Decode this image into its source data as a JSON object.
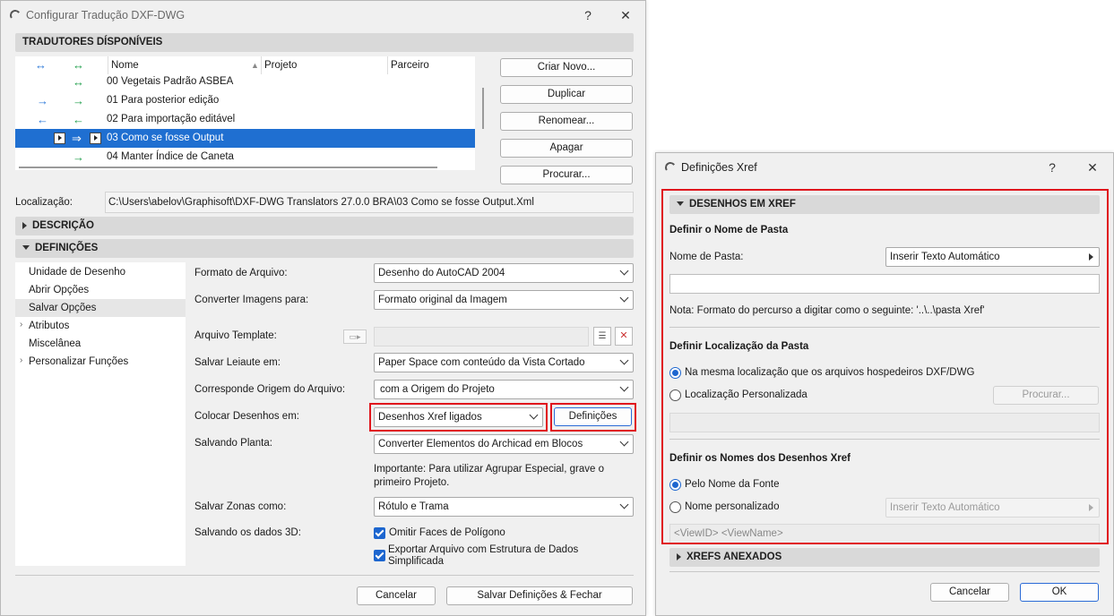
{
  "main": {
    "title": "Configurar Tradução DXF-DWG",
    "help": "?",
    "close": "✕",
    "translators_header": "TRADUTORES DÍSPONÍVEIS",
    "columns": {
      "name": "Nome",
      "project": "Projeto",
      "partner": "Parceiro"
    },
    "rows": [
      {
        "name": "00 Vegetais Padrão ASBEA"
      },
      {
        "name": "01 Para posterior edição"
      },
      {
        "name": "02 Para importação editável"
      },
      {
        "name": "03 Como se fosse Output"
      },
      {
        "name": "04 Manter Índice de Caneta"
      }
    ],
    "buttons": {
      "new": "Criar Novo...",
      "duplicate": "Duplicar",
      "rename": "Renomear...",
      "delete": "Apagar",
      "browse": "Procurar..."
    },
    "location_label": "Localização:",
    "location_value": "C:\\Users\\abelov\\Graphisoft\\DXF-DWG Translators 27.0.0 BRA\\03 Como se fosse Output.Xml",
    "description_header": "DESCRIÇÃO",
    "definitions_header": "DEFINIÇÕES",
    "nav": [
      "Unidade de Desenho",
      "Abrir Opções",
      "Salvar Opções",
      "Atributos",
      "Miscelânea",
      "Personalizar Funções"
    ],
    "settings": {
      "file_format_label": "Formato de Arquivo:",
      "file_format_value": "Desenho do AutoCAD 2004",
      "convert_images_label": "Converter Imagens para:",
      "convert_images_value": "Formato original da Imagem",
      "template_label": "Arquivo Template:",
      "layout_label": "Salvar Leiaute em:",
      "layout_value": "Paper Space com conteúdo da Vista Cortado",
      "origin_label": "Corresponde Origem do Arquivo:",
      "origin_value": "com a Origem do Projeto",
      "place_label": "Colocar Desenhos em:",
      "place_value": "Desenhos Xref ligados",
      "definitions_button": "Definições",
      "plan_label": "Salvando Planta:",
      "plan_value": "Converter Elementos do Archicad em Blocos",
      "important_note": "Importante: Para utilizar Agrupar Especial, grave o primeiro Projeto.",
      "zones_label": "Salvar Zonas como:",
      "zones_value": "Rótulo e Trama",
      "data3d_label": "Salvando os dados 3D:",
      "omit_faces": "Omitir Faces de Polígono",
      "export_structure": "Exportar Arquivo com Estrutura de Dados Simplificada"
    },
    "cancel": "Cancelar",
    "save_close": "Salvar Definições & Fechar"
  },
  "xref": {
    "title": "Definições Xref",
    "help": "?",
    "close": "✕",
    "section_drawings": "DESENHOS EM XREF",
    "folder_name_heading": "Definir o Nome de Pasta",
    "folder_name_label": "Nome de Pasta:",
    "insert_auto_text": "Inserir Texto Automático",
    "note": "Nota: Formato do percurso a digitar como o seguinte:   '..\\..\\pasta Xref'",
    "folder_location_heading": "Definir Localização da Pasta",
    "same_location": "Na mesma localização que os arquivos hospedeiros DXF/DWG",
    "custom_location": "Localização Personalizada",
    "browse": "Procurar...",
    "names_heading": "Definir os Nomes dos Desenhos Xref",
    "by_source": "Pelo Nome da Fonte",
    "custom_name": "Nome personalizado",
    "insert_auto_text2": "Inserir Texto Automático",
    "name_pattern": "<ViewID> <ViewName>",
    "section_attached": "XREFS ANEXADOS",
    "cancel": "Cancelar",
    "ok": "OK"
  },
  "colors": {
    "selection": "#1f6fd1",
    "highlight": "#e0161d",
    "checkbox": "#1d66cf"
  }
}
